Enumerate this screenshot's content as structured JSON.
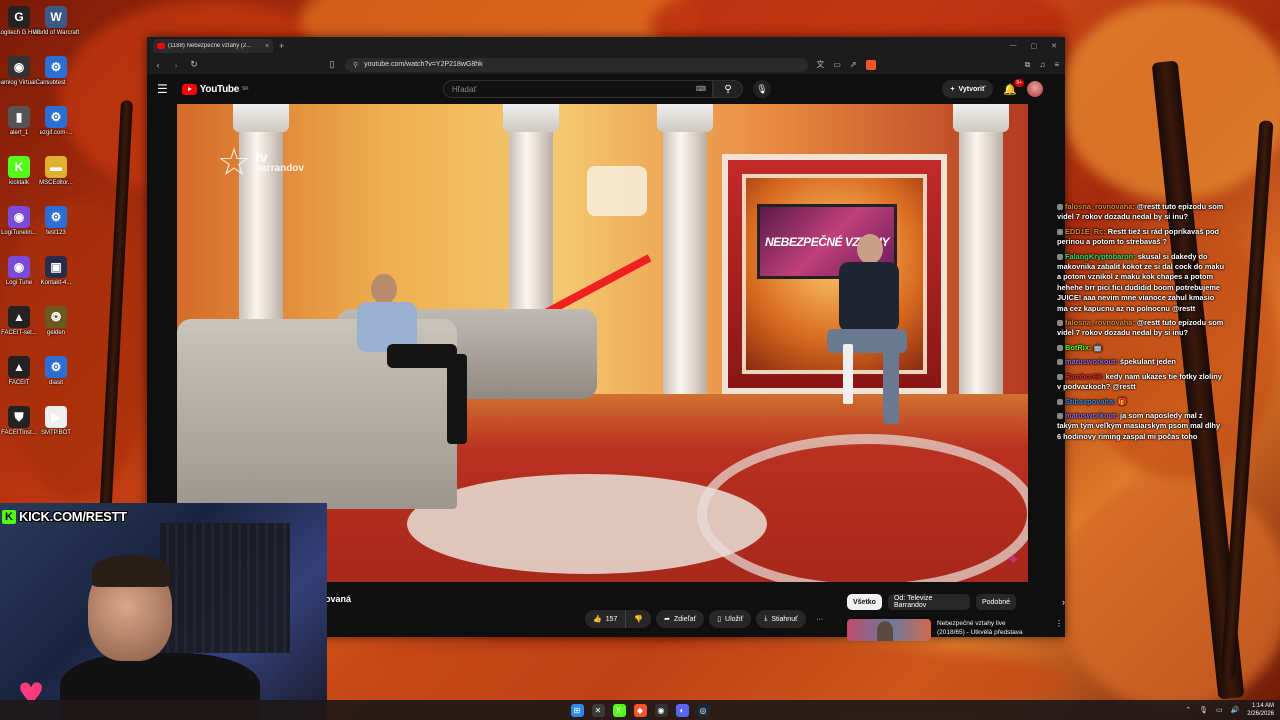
{
  "desktop": {
    "icons": [
      {
        "label": "Logitech G HUB",
        "glyph": "G",
        "color": "#222222"
      },
      {
        "label": "World of Warcraft",
        "glyph": "W",
        "color": "#3a5a8a"
      },
      {
        "label": "Streamlog VirtualCam",
        "glyph": "◉",
        "color": "#333333"
      },
      {
        "label": "subtest",
        "glyph": "⚙",
        "color": "#2b6fd6"
      },
      {
        "label": "alert_1",
        "glyph": "▮",
        "color": "#555555"
      },
      {
        "label": "ezgif.com-...",
        "glyph": "⚙",
        "color": "#2b6fd6"
      },
      {
        "label": "kicktalk",
        "glyph": "K",
        "color": "#53fc18"
      },
      {
        "label": "MSCEditor...",
        "glyph": "▬",
        "color": "#e0b030"
      },
      {
        "label": "LogiTunelin...",
        "glyph": "◉",
        "color": "#7a4ad8"
      },
      {
        "label": "test123",
        "glyph": "⚙",
        "color": "#2b6fd6"
      },
      {
        "label": "Logi Tune",
        "glyph": "◉",
        "color": "#7a4ad8"
      },
      {
        "label": "Kontakt-4...",
        "glyph": "▣",
        "color": "#2a2a4a"
      },
      {
        "label": "FACEIT-set...",
        "glyph": "▲",
        "color": "#222222"
      },
      {
        "label": "gelden",
        "glyph": "❂",
        "color": "#6a5a20"
      },
      {
        "label": "FACEIT",
        "glyph": "▲",
        "color": "#222222"
      },
      {
        "label": "diasit",
        "glyph": "⚙",
        "color": "#2b6fd6"
      },
      {
        "label": "FACEITInst...",
        "glyph": "⛊",
        "color": "#222222"
      },
      {
        "label": "SMTP.BOT",
        "glyph": "▶",
        "color": "#eeeeee"
      }
    ]
  },
  "browser": {
    "tab_title": "(1188) Nebezpečné vztahy (2...",
    "tab_close": "×",
    "new_tab": "+",
    "url": "youtube.com/watch?v=Y2P218wG8hk",
    "win_controls": [
      "—",
      "▢",
      "✕"
    ]
  },
  "youtube": {
    "logo_text": "YouTube",
    "logo_region": "SK",
    "search_placeholder": "Hľadať",
    "create_label": "Vytvoriť",
    "notif_count": "9+",
    "video": {
      "channel_logo_tv": "tv",
      "channel_logo_name": "barrandov",
      "screen_text": "NEBEZPEČNÉ VZTAHY",
      "title_fragment": "ovaná"
    },
    "actions": {
      "like_count": "157",
      "share_label": "Zdieľať",
      "save_label": "Uložiť",
      "download_label": "Stiahnuť",
      "more": "···"
    },
    "chips": [
      "Všetko",
      "Od: Televize Barrandov",
      "Podobné"
    ],
    "chip_next": "›",
    "recommended": {
      "title_line1": "Nebezpečné vztahy live",
      "title_line2": "(2018/65) - Utkvělá představa",
      "more": "⋮"
    }
  },
  "chat": [
    {
      "user": "falosna_rovnovaha:",
      "color": "#d98a30",
      "text": "@restt tuto epizodu som videl 7 rokov dozadu nedal by si inu?"
    },
    {
      "user": "EDD1E_Rc:",
      "color": "#d98a30",
      "text": "Restt tiež si rád popríkavaš pod perinou a potom to strebavaš ?"
    },
    {
      "user": "FalangKryptobaron:",
      "color": "#3ad86a",
      "text": "skusal si dakedy do makovnika zabalit kokot ze si dal cock do maku a potom vznikol z maku kok chapes a potom hehehe brr pici fici dudidid boom potrebujeme JUICE! aaa nevim mne vianoce zahul kmasio ma cez kapucnu az na polnocnu @restt"
    },
    {
      "user": "falosna_rovnovaha:",
      "color": "#d98a30",
      "text": "@restt tuto epizodu som videl 7 rokov dozadu nedal by si inu?"
    },
    {
      "user": "BotRix:",
      "color": "#53fc18",
      "text": "🤖"
    },
    {
      "user": "matusworkout:",
      "color": "#8a6ae0",
      "text": "špekulant jeden"
    },
    {
      "user": "Rambor69:",
      "color": "#e0303a",
      "text": "kedy nam ukazes tie fotky zloliny v podvazkoch? @restt"
    },
    {
      "user": "Stibaxpovaha:",
      "color": "#3a8ae0",
      "text": "🎁"
    },
    {
      "user": "matusworkout:",
      "color": "#8a6ae0",
      "text": "ja som naposledy mal z takým tým veľkým masiarskym psom mal dlhy 6 hodinovy riming zaspal mi počas toho"
    }
  ],
  "webcam": {
    "kick_k": "K",
    "banner": "KICK.COM/RESTT"
  },
  "taskbar": {
    "icons": [
      {
        "name": "start-icon",
        "glyph": "⊞",
        "color": "#2b8ae8"
      },
      {
        "name": "xbox-icon",
        "glyph": "✕",
        "color": "#3a3a3a"
      },
      {
        "name": "kick-app-icon",
        "glyph": "K",
        "color": "#53fc18"
      },
      {
        "name": "brave-icon",
        "glyph": "◆",
        "color": "#fb542b"
      },
      {
        "name": "obs-icon",
        "glyph": "◉",
        "color": "#333333"
      },
      {
        "name": "discord-icon",
        "glyph": "◐",
        "color": "#5865f2"
      },
      {
        "name": "steam-icon",
        "glyph": "◎",
        "color": "#1b2838"
      }
    ],
    "time": "1:14 AM",
    "date": "2/26/2026"
  }
}
